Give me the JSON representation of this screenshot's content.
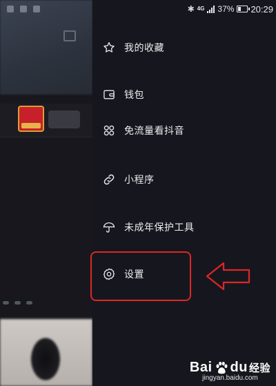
{
  "status_bar": {
    "network": "4G",
    "battery": "37%",
    "time": "20:29"
  },
  "menu": {
    "items": [
      {
        "label": "我的收藏",
        "icon": "star-icon"
      },
      {
        "label": "钱包",
        "icon": "wallet-icon"
      },
      {
        "label": "免流量看抖音",
        "icon": "grid-circles-icon"
      },
      {
        "label": "小程序",
        "icon": "link-icon"
      },
      {
        "label": "未成年保护工具",
        "icon": "umbrella-icon"
      },
      {
        "label": "设置",
        "icon": "settings-gear-icon"
      }
    ]
  },
  "annotation": {
    "highlight_color": "#e02626",
    "points_to": "设置"
  },
  "watermark": {
    "brand_latin": "Bai",
    "brand_latin_2": "du",
    "brand_cn": "经验",
    "site": "jingyan.baidu.com"
  },
  "colors": {
    "drawer_bg": "#16171e",
    "text": "#ececef",
    "accent_red": "#e02626"
  }
}
